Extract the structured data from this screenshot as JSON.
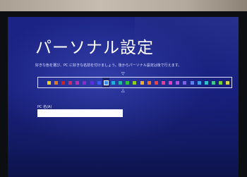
{
  "setup": {
    "title": "パーソナル設定",
    "description": "好きな色を選び、PC に好きな名前を付けましょう。後からパーソナル設定は後で行えます。",
    "palette": [
      {
        "color": "#1e2aa0",
        "selected": false
      },
      {
        "color": "#f0d020",
        "selected": false
      },
      {
        "color": "#e07a20",
        "selected": false
      },
      {
        "color": "#d02020",
        "selected": false
      },
      {
        "color": "#d02a6a",
        "selected": false
      },
      {
        "color": "#c02ab0",
        "selected": false
      },
      {
        "color": "#8a2ad0",
        "selected": false
      },
      {
        "color": "#5a30d8",
        "selected": false
      },
      {
        "color": "#3a5af0",
        "selected": false
      },
      {
        "color": "#3a8af0",
        "selected": true
      },
      {
        "color": "#20b0e0",
        "selected": false
      },
      {
        "color": "#20b8a0",
        "selected": false
      },
      {
        "color": "#30c040",
        "selected": false
      },
      {
        "color": "#90d020",
        "selected": false
      },
      {
        "color": "#f0b020",
        "selected": false
      },
      {
        "color": "#f07020",
        "selected": false
      },
      {
        "color": "#f04040",
        "selected": false
      },
      {
        "color": "#f03a90",
        "selected": false
      },
      {
        "color": "#e040c0",
        "selected": false
      },
      {
        "color": "#b050e0",
        "selected": false
      },
      {
        "color": "#8060e8",
        "selected": false
      },
      {
        "color": "#6080f0",
        "selected": false
      },
      {
        "color": "#40a0f0",
        "selected": false
      },
      {
        "color": "#30c0d0",
        "selected": false
      },
      {
        "color": "#40c890",
        "selected": false
      },
      {
        "color": "#70d040",
        "selected": false
      },
      {
        "color": "#d0d040",
        "selected": false
      }
    ],
    "pc_name_label": "PC 名(A)",
    "pc_name_value": ""
  },
  "icons": {
    "marker_top": "▽",
    "marker_bottom": "△"
  }
}
